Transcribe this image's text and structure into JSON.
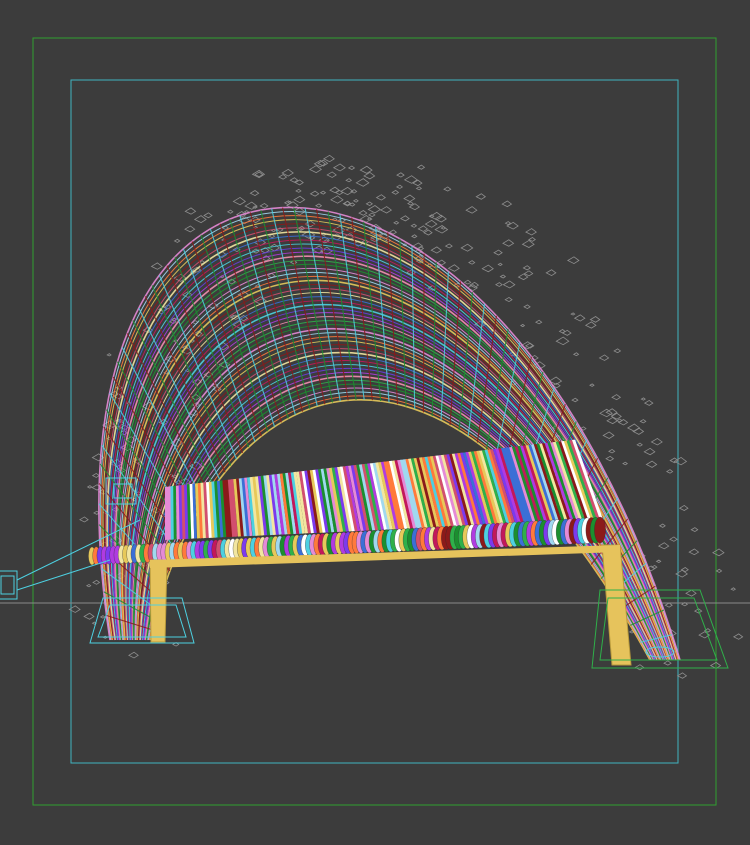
{
  "viewport": {
    "background": "#3c3c3c",
    "frame_colors": {
      "safe_frame_outer": "#2fa02f",
      "safe_frame_inner": "#3fb3c0",
      "horizon": "#8a8a8a"
    }
  },
  "scene": {
    "wire_palette": [
      "#e7c95a",
      "#d24f6e",
      "#3b6fd6",
      "#4dd0e1",
      "#b03be0",
      "#2fb04a",
      "#e58ad6",
      "#ff7a3b",
      "#8b1a1a",
      "#f2e6a0",
      "#c2185b",
      "#6a3de0",
      "#f48fb1",
      "#1b8f2f",
      "#a0d8ef"
    ],
    "bench_palette": [
      "#e7c95a",
      "#d24f6e",
      "#2fb04a",
      "#4dd0e1",
      "#b03be0",
      "#e58ad6",
      "#f2e6a0",
      "#8b1a1a",
      "#3b6fd6",
      "#ffffff",
      "#ff7a3b",
      "#1b8f2f",
      "#c2185b",
      "#a0d8ef",
      "#7c3aed"
    ],
    "leg_color": "#e6c35c",
    "foliage_color": "#8e8e8e",
    "objects": [
      "wire-arch-canopy",
      "slatted-bench",
      "bench-legs",
      "leaf-scatter",
      "camera-gizmo"
    ]
  }
}
